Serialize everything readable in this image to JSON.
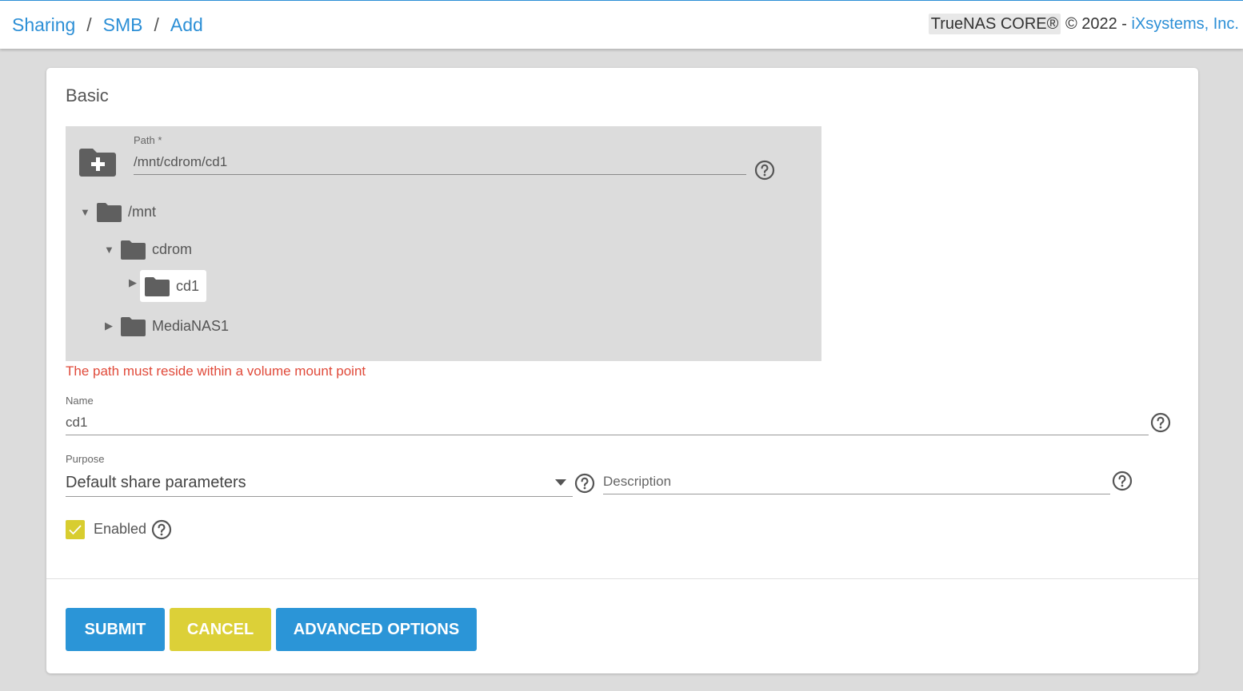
{
  "breadcrumb": {
    "items": [
      "Sharing",
      "SMB",
      "Add"
    ],
    "separator": "/"
  },
  "copyright": {
    "product": "TrueNAS CORE®",
    "text": "© 2022 -",
    "company": "iXsystems, Inc."
  },
  "form": {
    "section_title": "Basic",
    "path": {
      "label": "Path *",
      "value": "/mnt/cdrom/cd1"
    },
    "tree": {
      "root": "/mnt",
      "child": "cdrom",
      "grandchild": "cd1",
      "sibling": "MediaNAS1"
    },
    "error": "The path must reside within a volume mount point",
    "name": {
      "label": "Name",
      "value": "cd1"
    },
    "purpose": {
      "label": "Purpose",
      "selected": "Default share parameters"
    },
    "description": {
      "placeholder": "Description"
    },
    "enabled": {
      "label": "Enabled",
      "checked": true
    }
  },
  "buttons": {
    "submit": "SUBMIT",
    "cancel": "CANCEL",
    "advanced": "ADVANCED OPTIONS"
  },
  "colors": {
    "accent": "#2b95d7",
    "warning": "#dcd038",
    "error": "#e04a3a"
  }
}
